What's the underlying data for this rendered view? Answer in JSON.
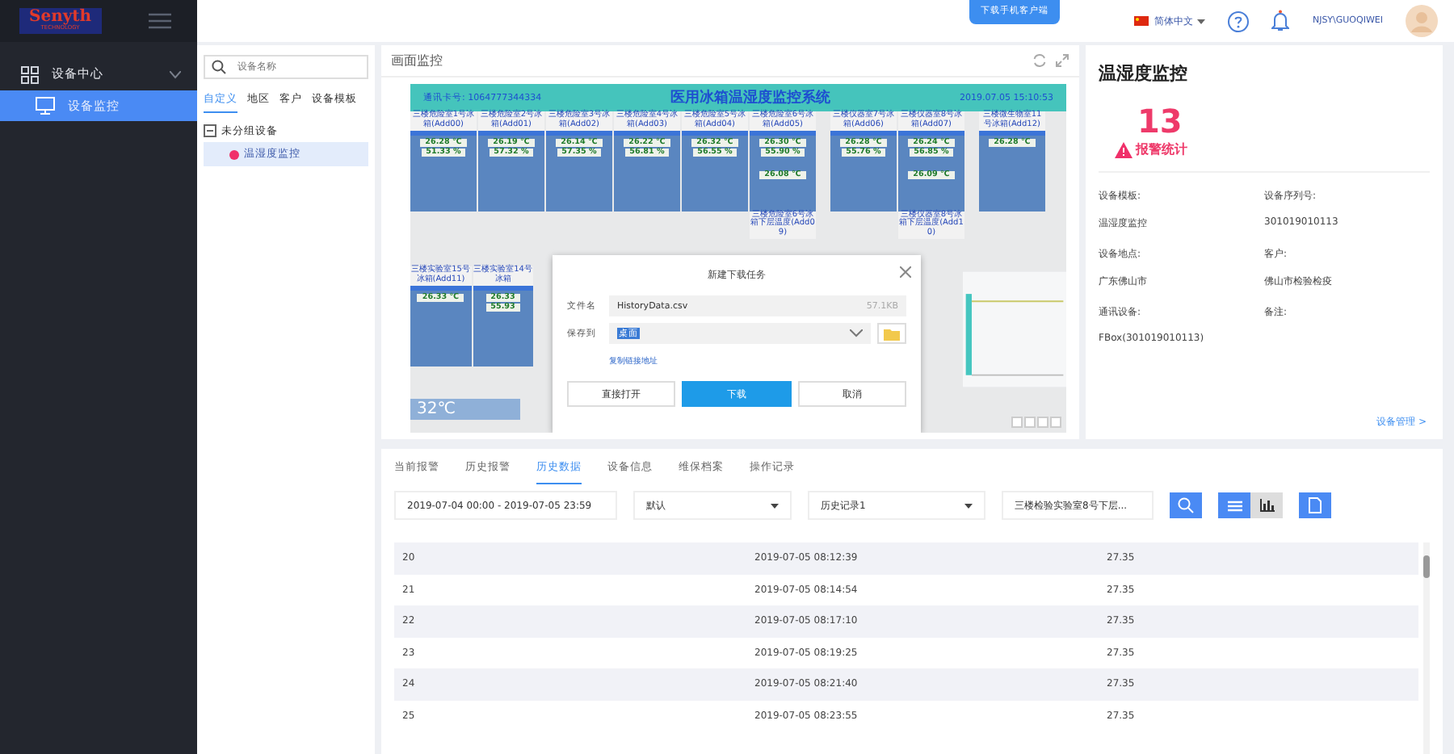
{
  "sidebar": {
    "logo": "Senyth",
    "logo_sub": "TECHNOLOGY",
    "menu": [
      {
        "label": "设备中心",
        "expanded": true,
        "children": [
          {
            "label": "设备监控",
            "selected": true
          }
        ]
      }
    ]
  },
  "topbar": {
    "download_tab": "下载手机客户端",
    "language": "简体中文",
    "user": "NJSY\\GUOQIWEI"
  },
  "tree": {
    "search": {
      "placeholder": "设备名称"
    },
    "tabs": [
      {
        "label": "自定义",
        "selected": true
      },
      {
        "label": "地区",
        "selected": false
      },
      {
        "label": "客户",
        "selected": false
      },
      {
        "label": "设备模板",
        "selected": false
      }
    ],
    "nodes": [
      {
        "label": "未分组设备",
        "expanded": true,
        "children": [
          {
            "label": "温湿度监控",
            "selected": true,
            "color": "#f0306a"
          }
        ]
      }
    ]
  },
  "monitor": {
    "title": "画面监控",
    "scada": {
      "card_no": "通讯卡号: 1064777344334",
      "title": "医用冰箱温湿度监控系统",
      "time": "2019.07.05 15:10:53",
      "tiles": [
        {
          "label": "三楼危险室1号冰箱(Add00)",
          "readings": [
            "26.28 ℃",
            "51.33 %"
          ]
        },
        {
          "label": "三楼危险室2号冰箱(Add01)",
          "readings": [
            "26.19 ℃",
            "57.32 %"
          ]
        },
        {
          "label": "三楼危险室3号冰箱(Add02)",
          "readings": [
            "26.14 ℃",
            "57.35 %"
          ]
        },
        {
          "label": "三楼危险室4号冰箱(Add03)",
          "readings": [
            "26.22 ℃",
            "56.81 %"
          ]
        },
        {
          "label": "三楼危险室5号冰箱(Add04)",
          "readings": [
            "26.32 ℃",
            "56.55 %"
          ]
        },
        {
          "label": "三楼危险室6号冰箱(Add05)",
          "readings": [
            "26.30 ℃",
            "55.90 %",
            "26.08 ℃"
          ],
          "lower_label": "三楼危险室6号冰箱下层温度(Add09)"
        },
        {
          "label": "三楼仪器室7号冰箱(Add06)",
          "readings": [
            "26.28 ℃",
            "55.76 %"
          ]
        },
        {
          "label": "三楼仪器室8号冰箱(Add07)",
          "readings": [
            "26.24 ℃",
            "56.85 %",
            "26.09 ℃"
          ],
          "lower_label": "三楼仪器室8号冰箱下层温度(Add10)"
        },
        {
          "label": "三楼微生物室11号冰箱(Add12)",
          "readings": [
            "26.28 ℃"
          ]
        }
      ],
      "lower_tiles": [
        {
          "label": "三楼实验室15号冰箱(Add11)",
          "readings": [
            "26.33 ℃"
          ]
        },
        {
          "label": "三楼实验室14号冰箱",
          "readings": [
            "26.33",
            "55.93"
          ]
        }
      ],
      "weather": "32℃"
    },
    "dialog": {
      "title": "新建下载任务",
      "filename_label": "文件名",
      "filename": "HistoryData.csv",
      "size": "57.1KB",
      "save_label": "保存到",
      "save_to": "桌面",
      "copy_link": "复制链接地址",
      "buttons": [
        {
          "label": "直接打开",
          "kind": "plain"
        },
        {
          "label": "下载",
          "kind": "primary"
        },
        {
          "label": "取消",
          "kind": "plain"
        }
      ]
    }
  },
  "device": {
    "title": "温湿度监控",
    "alarm_count": "13",
    "alarm_label": "报警统计",
    "fields": [
      {
        "label": "设备模板:",
        "value": "温湿度监控"
      },
      {
        "label": "设备序列号:",
        "value": "301019010113"
      },
      {
        "label": "设备地点:",
        "value": "广东佛山市"
      },
      {
        "label": "客户:",
        "value": "佛山市检验检疫"
      },
      {
        "label": "通讯设备:",
        "value": "FBox(301019010113)"
      },
      {
        "label": "备注:"
      }
    ],
    "link": "设备管理 >"
  },
  "history": {
    "tabs": [
      {
        "label": "当前报警",
        "selected": false
      },
      {
        "label": "历史报警",
        "selected": false
      },
      {
        "label": "历史数据",
        "selected": true
      },
      {
        "label": "设备信息",
        "selected": false
      },
      {
        "label": "维保档案",
        "selected": false
      },
      {
        "label": "操作记录",
        "selected": false
      }
    ],
    "date_range": "2019-07-04 00:00 - 2019-07-05 23:59",
    "select_1": "默认",
    "select_2": "历史记录1",
    "device": "三楼检验实验室8号下层...",
    "views": [
      {
        "kind": "list",
        "selected": true
      },
      {
        "kind": "chart",
        "selected": false
      }
    ],
    "rows": [
      [
        "20",
        "2019-07-05 08:12:39",
        "27.35"
      ],
      [
        "21",
        "2019-07-05 08:14:54",
        "27.35"
      ],
      [
        "22",
        "2019-07-05 08:17:10",
        "27.35"
      ],
      [
        "23",
        "2019-07-05 08:19:25",
        "27.35"
      ],
      [
        "24",
        "2019-07-05 08:21:40",
        "27.35"
      ],
      [
        "25",
        "2019-07-05 08:23:55",
        "27.35"
      ]
    ]
  }
}
